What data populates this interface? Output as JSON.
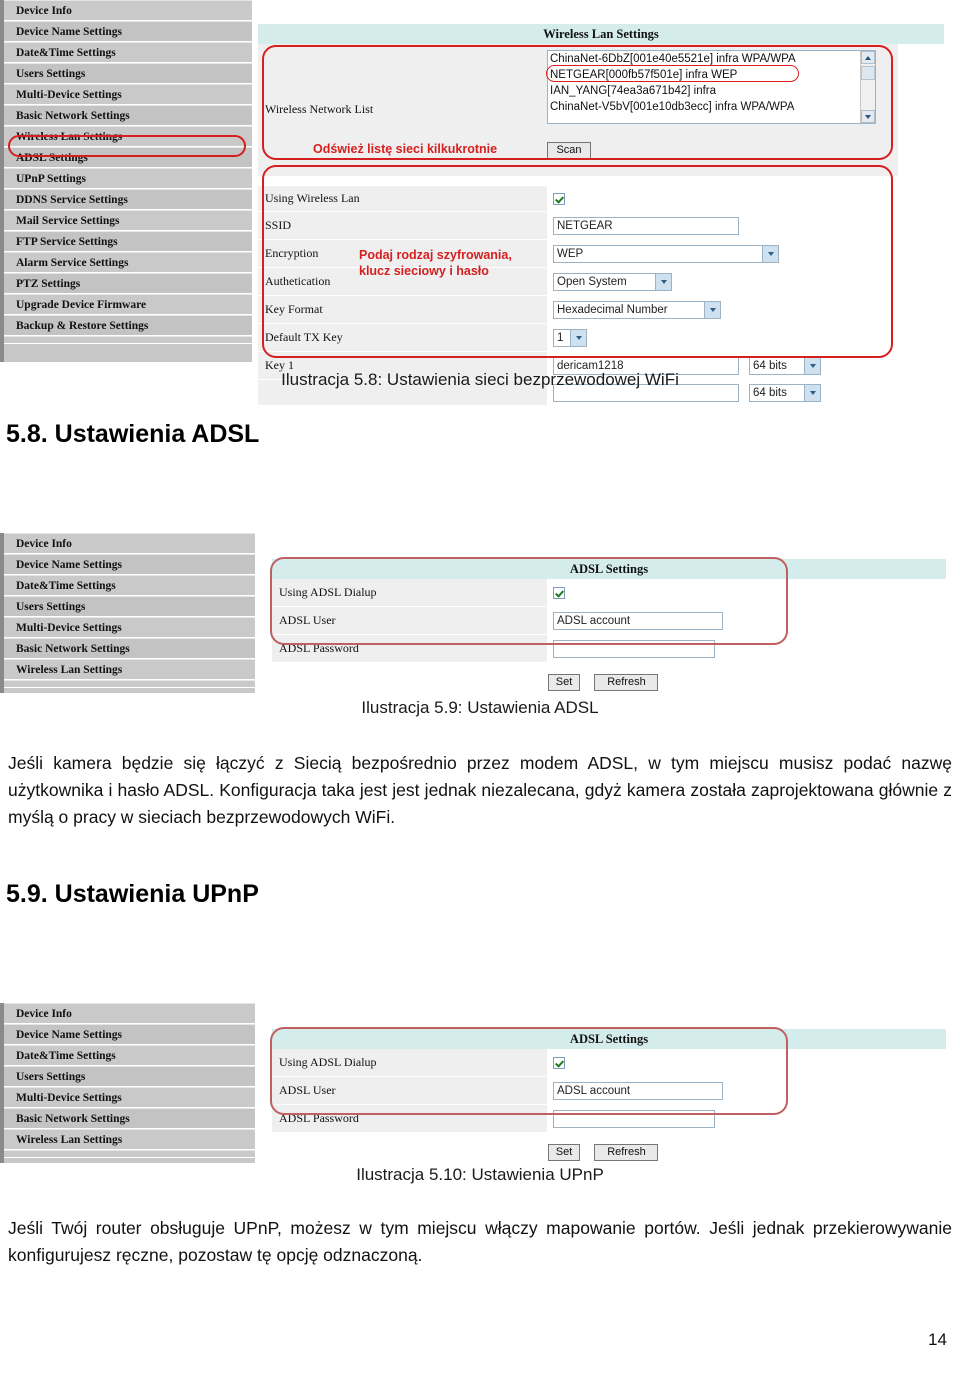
{
  "page": {
    "number": "14"
  },
  "figure_wifi": {
    "sidebar_items": [
      "Device Info",
      "Device Name Settings",
      "Date&Time Settings",
      "Users Settings",
      "Multi-Device Settings",
      "Basic Network Settings",
      "Wireless Lan Settings",
      "ADSL Settings",
      "UPnP Settings",
      "DDNS Service Settings",
      "Mail Service Settings",
      "FTP Service Settings",
      "Alarm Service Settings",
      "PTZ Settings",
      "Upgrade Device Firmware",
      "Backup & Restore Settings"
    ],
    "sidebar_selected": "Wireless Lan Settings",
    "panel_title": "Wireless Lan Settings",
    "network_list_label": "Wireless Network List",
    "networks": [
      "ChinaNet-6DbZ[001e40e5521e] infra WPA/WPA",
      "NETGEAR[000fb57f501e] infra WEP",
      "IAN_YANG[74ea3a671b42] infra",
      "ChinaNet-V5bV[001e10db3ecc] infra WPA/WPA"
    ],
    "network_selected": "NETGEAR[000fb57f501e] infra WEP",
    "scan_button": "Scan",
    "annotation_scan": "Odśwież listę sieci kilkukrotnie",
    "annotation_encryption_line1": "Podaj rodzaj szyfrowania,",
    "annotation_encryption_line2": "klucz sieciowy i hasło",
    "rows": {
      "using_wireless_lan_label": "Using Wireless Lan",
      "using_wireless_lan_checked": true,
      "ssid_label": "SSID",
      "ssid_value": "NETGEAR",
      "encryption_label": "Encryption",
      "encryption_value": "WEP",
      "authetication_label": "Authetication",
      "authetication_value": "Open System",
      "key_format_label": "Key Format",
      "key_format_value": "Hexadecimal Number",
      "default_tx_key_label": "Default TX Key",
      "default_tx_key_value": "1",
      "key1_label": "Key 1",
      "key1_value": "dericam1218",
      "key1_bits": "64 bits",
      "key2_bits": "64 bits"
    }
  },
  "caption_58": "Ilustracja 5.8: Ustawienia sieci bezprzewodowej WiFi",
  "heading_58": "5.8. Ustawienia ADSL",
  "figure_adsl": {
    "sidebar_items": [
      "Device Info",
      "Device Name Settings",
      "Date&Time Settings",
      "Users Settings",
      "Multi-Device Settings",
      "Basic Network Settings",
      "Wireless Lan Settings"
    ],
    "panel_title": "ADSL Settings",
    "rows": {
      "using_adsl_dialup_label": "Using ADSL Dialup",
      "using_adsl_dialup_checked": true,
      "adsl_user_label": "ADSL User",
      "adsl_user_value": "ADSL account",
      "adsl_password_label": "ADSL Password",
      "adsl_password_value": ""
    },
    "set_button": "Set",
    "refresh_button": "Refresh"
  },
  "caption_59": "Ilustracja 5.9: Ustawienia ADSL",
  "paragraph_adsl": "Jeśli kamera będzie się łączyć z Siecią bezpośrednio przez modem ADSL, w tym miejscu musisz podać nazwę użytkownika i hasło ADSL. Konfiguracja taka jest jest jednak niezalecana, gdyż kamera została zaprojektowana głównie z myślą o pracy w sieciach bezprzewodowych WiFi.",
  "heading_59": "5.9. Ustawienia UPnP",
  "figure_upnp": {
    "sidebar_items": [
      "Device Info",
      "Device Name Settings",
      "Date&Time Settings",
      "Users Settings",
      "Multi-Device Settings",
      "Basic Network Settings",
      "Wireless Lan Settings"
    ],
    "panel_title": "ADSL Settings",
    "rows": {
      "using_adsl_dialup_label": "Using ADSL Dialup",
      "using_adsl_dialup_checked": true,
      "adsl_user_label": "ADSL User",
      "adsl_user_value": "ADSL account",
      "adsl_password_label": "ADSL Password",
      "adsl_password_value": ""
    },
    "set_button": "Set",
    "refresh_button": "Refresh"
  },
  "caption_510": "Ilustracja 5.10: Ustawienia UPnP",
  "paragraph_upnp": "Jeśli Twój router obsługuje UPnP, możesz w tym miejscu włączy mapowanie portów. Jeśli jednak przekierowywanie konfigurujesz ręczne, pozostaw tę opcję odznaczoną.",
  "colors": {
    "panel_header": "#d4ecec",
    "sidebar": "#c8c8c8",
    "annotation_red": "#d52020",
    "row_label_bg": "#efefef"
  }
}
